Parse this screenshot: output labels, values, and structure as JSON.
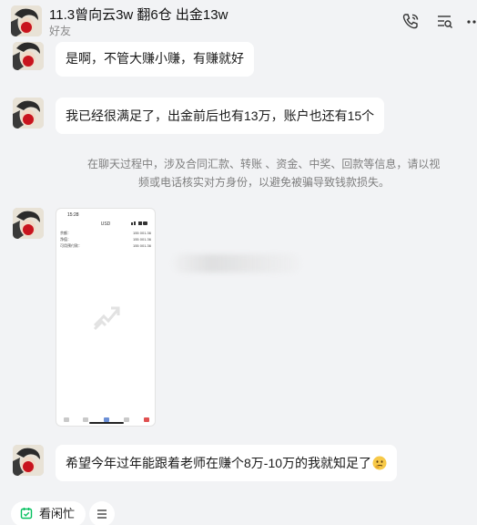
{
  "header": {
    "title": "11.3曾向云3w 翻6仓 出金13w",
    "subtitle": "好友"
  },
  "header_icons": [
    "phone-sync-icon",
    "list-icon",
    "more-icon"
  ],
  "messages": [
    {
      "text": "是啊，不管大赚小赚，有赚就好"
    },
    {
      "text": "我已经很满足了，出金前后也有13万，账户也还有15个"
    },
    {
      "text": "希望今年过年能跟着老师在赚个8万-10万的我就知足了"
    }
  ],
  "notice": {
    "line1": "在聊天过程中，涉及合同汇款、转账 、资金、中奖、回款等信息，请以视",
    "line2": "频或电话核实对方身份，以避免被骗导致钱款损失。"
  },
  "phone_screenshot": {
    "time": "15:28",
    "currency": "USD",
    "rows": [
      {
        "label": "余额：",
        "value": "155 001.36"
      },
      {
        "label": "净值：",
        "value": "155 001.36"
      },
      {
        "label": "可用预付款：",
        "value": "155 001.36"
      }
    ]
  },
  "bottom": {
    "quick_label": "看闲忙"
  },
  "colors": {
    "background": "#f2f3f5",
    "bubble": "#ffffff",
    "accent_green": "#07c160"
  }
}
